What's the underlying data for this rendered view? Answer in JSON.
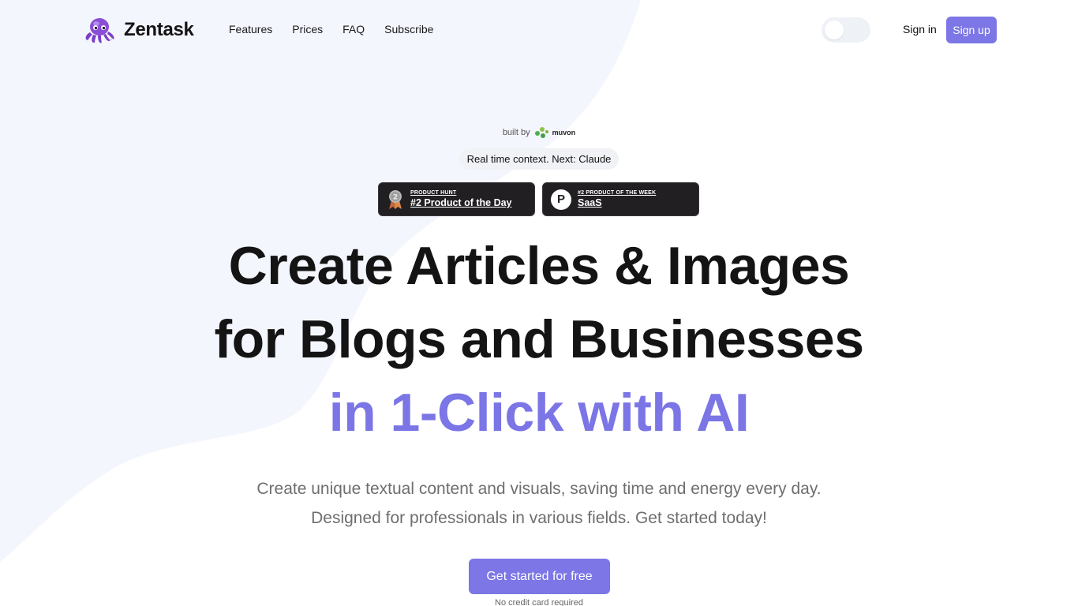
{
  "brand": {
    "name": "Zentask"
  },
  "nav": {
    "items": [
      "Features",
      "Prices",
      "FAQ",
      "Subscribe"
    ]
  },
  "auth": {
    "sign_in": "Sign in",
    "sign_up": "Sign up"
  },
  "theme_toggle": {
    "state": "light"
  },
  "hero": {
    "built_by_label": "built by",
    "built_by_brand": "muvon",
    "context_pill": "Real time context. Next: Claude",
    "badges": [
      {
        "eyebrow": "PRODUCT HUNT",
        "title": "#2 Product of the Day",
        "icon": "silver-medal-icon"
      },
      {
        "eyebrow": "#2 PRODUCT OF THE WEEK",
        "title": "SaaS",
        "icon": "product-hunt-p-icon"
      }
    ],
    "headline_lines": [
      "Create Articles & Images",
      "for Blogs and Businesses",
      "in 1-Click with AI"
    ],
    "subtitle_lines": [
      "Create unique textual content and visuals, saving time and energy every day.",
      "Designed for professionals in various fields. Get started today!"
    ],
    "cta": "Get started for free",
    "cta_note": "No credit card required"
  },
  "colors": {
    "accent": "#7c76e6",
    "background_blob": "#f5f7fd",
    "badge_bg": "#221f22",
    "text_dark": "#141414"
  }
}
